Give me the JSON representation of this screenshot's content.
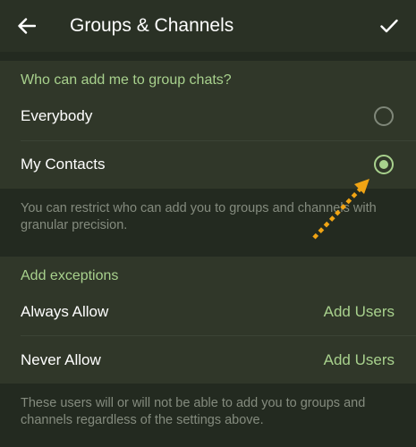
{
  "header": {
    "title": "Groups & Channels",
    "back_icon": "arrow-left-icon",
    "confirm_icon": "checkmark-icon"
  },
  "privacy": {
    "header": "Who can add me to group chats?",
    "options": [
      {
        "label": "Everybody",
        "selected": false
      },
      {
        "label": "My Contacts",
        "selected": true
      }
    ],
    "info": "You can restrict who can add you to groups and channels with granular precision."
  },
  "exceptions": {
    "header": "Add exceptions",
    "rows": [
      {
        "label": "Always Allow",
        "action": "Add Users"
      },
      {
        "label": "Never Allow",
        "action": "Add Users"
      }
    ],
    "info": "These users will or will not be able to add you to groups and channels regardless of the settings above."
  },
  "colors": {
    "accent": "#a8d18d",
    "background": "#232a20",
    "section": "#303729",
    "annotation_arrow": "#f0a414"
  }
}
